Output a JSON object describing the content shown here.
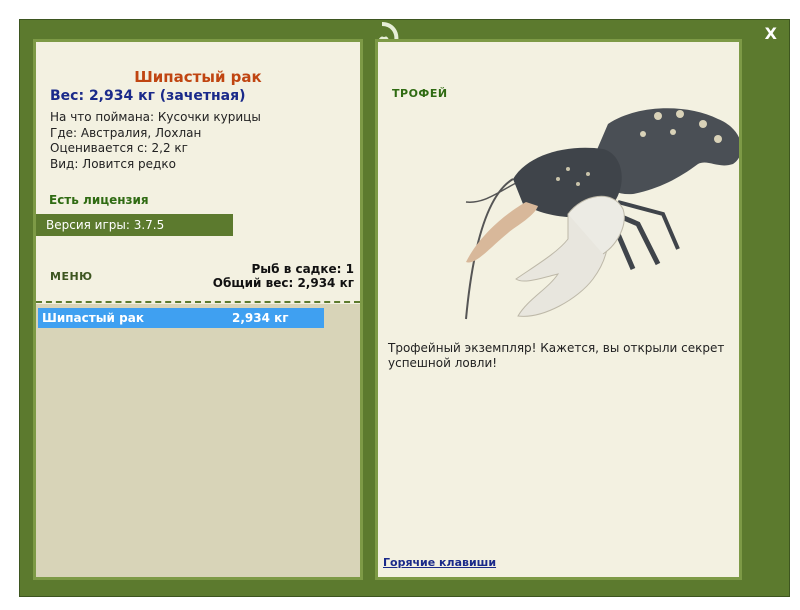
{
  "window": {
    "close_label": "X"
  },
  "fish": {
    "name": "Шипастый рак",
    "weight_line": "Вес: 2,934 кг (зачетная)",
    "bait": "На что поймана: Кусочки курицы",
    "location": "Где: Австралия, Лохлан",
    "price": "Оценивается с: 2,2 кг",
    "kind": "Вид: Ловится редко"
  },
  "license": "Есть лицензия",
  "version": "Версия игры: 3.7.5",
  "menu_label": "МЕНЮ",
  "keepnet": {
    "count": "Рыб в садке: 1",
    "total": "Общий вес: 2,934 кг"
  },
  "catch_list": [
    {
      "name": "Шипастый рак",
      "weight": "2,934 кг"
    }
  ],
  "trophy_label": "ТРОФЕЙ",
  "description": "Трофейный экземпляр! Кажется, вы открыли секрет успешной ловли!",
  "hotkeys_label": "Горячие клавиши",
  "colors": {
    "frame": "#5c7a2e",
    "panel": "#f3f1e1",
    "title": "#c04511",
    "weight": "#1a2a8a",
    "selection": "#3fa0f1"
  }
}
